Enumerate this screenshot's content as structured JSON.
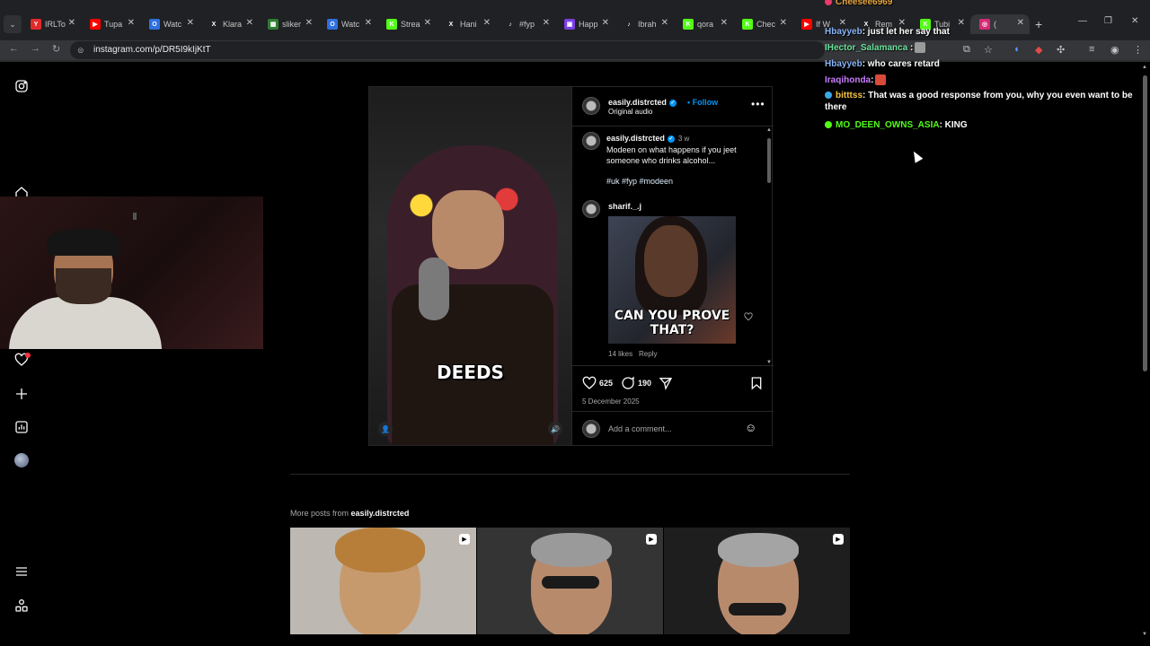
{
  "browser": {
    "tabs": [
      {
        "label": "IRLTo",
        "fav_color": "#e02b2b",
        "fav": "Y"
      },
      {
        "label": "Tupa",
        "fav_color": "#ff0000",
        "fav": "▶"
      },
      {
        "label": "Watc",
        "fav_color": "#2f6fe0",
        "fav": "O"
      },
      {
        "label": "Klara",
        "fav_color": "#202124",
        "fav": "X"
      },
      {
        "label": "sliker",
        "fav_color": "#2e7d32",
        "fav": "▦"
      },
      {
        "label": "Watc",
        "fav_color": "#2f6fe0",
        "fav": "O"
      },
      {
        "label": "Strea",
        "fav_color": "#53fc18",
        "fav": "K"
      },
      {
        "label": "Hani",
        "fav_color": "#202124",
        "fav": "X"
      },
      {
        "label": "#fyp",
        "fav_color": "#202124",
        "fav": "♪"
      },
      {
        "label": "Happ",
        "fav_color": "#7b3fe4",
        "fav": "▣"
      },
      {
        "label": "Ibrah",
        "fav_color": "#202124",
        "fav": "♪"
      },
      {
        "label": "qora",
        "fav_color": "#53fc18",
        "fav": "K"
      },
      {
        "label": "Chec",
        "fav_color": "#53fc18",
        "fav": "K"
      },
      {
        "label": "If W",
        "fav_color": "#ff0000",
        "fav": "▶"
      },
      {
        "label": "Rem",
        "fav_color": "#202124",
        "fav": "X"
      },
      {
        "label": "Tubi",
        "fav_color": "#53fc18",
        "fav": "K"
      },
      {
        "label": "(",
        "fav_color": "#d62976",
        "fav": "◎"
      }
    ],
    "url": "instagram.com/p/DR5I9kIjKtT"
  },
  "post": {
    "username": "easily.distrcted",
    "follow_label": "Follow",
    "audio": "Original audio",
    "video_caption": "DEEDS",
    "caption_user": "easily.distrcted",
    "caption_time": "3 w",
    "caption_text": "Modeen on what happens if you jeet someone who drinks alcohol...",
    "hashtags": "#uk #fyp #modeen",
    "comment_user": "sharif._.j",
    "gif_text": "CAN YOU PROVE THAT?",
    "comment_likes": "14 likes",
    "reply_label": "Reply",
    "likes_count": "625",
    "comments_count": "190",
    "date": "5 December 2025",
    "add_comment_placeholder": "Add a comment..."
  },
  "more_posts": {
    "prefix": "More posts from",
    "user": "easily.distrcted"
  },
  "chat": [
    {
      "user": "Cheesee6969",
      "text": "",
      "color": "#e6a33b",
      "badge": "#e63b6b"
    },
    {
      "user": "Hbayyeb",
      "text": ": just let her say that",
      "color": "#8ab4f8",
      "badge": ""
    },
    {
      "user": "IHector_Salamanca",
      "text": " :",
      "color": "#6be39c",
      "badge": ""
    },
    {
      "user": "Hbayyeb",
      "text": ": who cares retard",
      "color": "#8ab4f8",
      "badge": ""
    },
    {
      "user": "Iraqihonda",
      "text": ":",
      "color": "#c77dff",
      "badge": ""
    },
    {
      "user": "bitttss",
      "text": ": That was a good response from you, why you even want to be there",
      "color": "#f5c542",
      "badge": "#3ba7e6"
    },
    {
      "user": "MO_DEEN_OWNS_ASIA",
      "text": ": KING",
      "color": "#53fc18",
      "badge": "#53fc18"
    }
  ],
  "colors": {
    "accent": "#0095f6",
    "kick_green": "#53fc18",
    "notif_red": "#ff3040"
  }
}
